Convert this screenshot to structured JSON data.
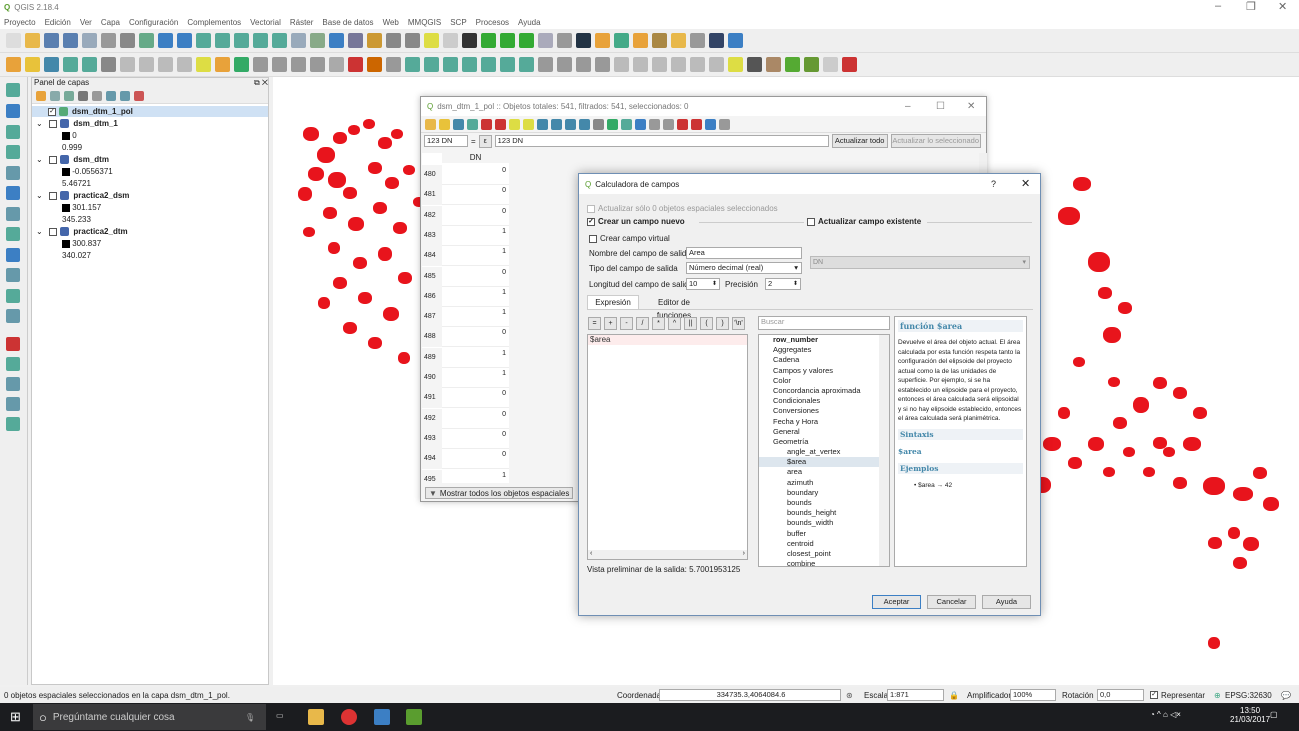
{
  "window": {
    "title": "QGIS 2.18.4"
  },
  "menu": [
    "Proyecto",
    "Edición",
    "Ver",
    "Capa",
    "Configuración",
    "Complementos",
    "Vectorial",
    "Ráster",
    "Base de datos",
    "Web",
    "MMQGIS",
    "SCP",
    "Procesos",
    "Ayuda"
  ],
  "layers_panel": {
    "title": "Panel de capas",
    "items": [
      {
        "name": "dsm_dtm_1_pol",
        "values": []
      },
      {
        "name": "dsm_dtm_1",
        "values": [
          "0",
          "0.999"
        ]
      },
      {
        "name": "dsm_dtm",
        "values": [
          "-0.0556371",
          "5.46721"
        ]
      },
      {
        "name": "practica2_dsm",
        "values": [
          "301.157",
          "345.233"
        ]
      },
      {
        "name": "practica2_dtm",
        "values": [
          "300.837",
          "340.027"
        ]
      }
    ]
  },
  "attr_table": {
    "title": "dsm_dtm_1_pol :: Objetos totales: 541, filtrados: 541, seleccionados: 0",
    "field_selector": "123 DN",
    "expr_text": "123 DN",
    "update_all": "Actualizar todo",
    "update_selected": "Actualizar lo seleccionado",
    "column": "DN",
    "rows": [
      {
        "id": "480",
        "dn": "0"
      },
      {
        "id": "481",
        "dn": "0"
      },
      {
        "id": "482",
        "dn": "0"
      },
      {
        "id": "483",
        "dn": "1"
      },
      {
        "id": "484",
        "dn": "1"
      },
      {
        "id": "485",
        "dn": "0"
      },
      {
        "id": "486",
        "dn": "1"
      },
      {
        "id": "487",
        "dn": "1"
      },
      {
        "id": "488",
        "dn": "0"
      },
      {
        "id": "489",
        "dn": "1"
      },
      {
        "id": "490",
        "dn": "1"
      },
      {
        "id": "491",
        "dn": "0"
      },
      {
        "id": "492",
        "dn": "0"
      },
      {
        "id": "493",
        "dn": "0"
      },
      {
        "id": "494",
        "dn": "0"
      },
      {
        "id": "495",
        "dn": "1"
      }
    ],
    "show_all": "Mostrar todos los objetos espaciales"
  },
  "field_calc": {
    "title": "Calculadora de campos",
    "update_selected_only": "Actualizar sólo 0 objetos espaciales seleccionados",
    "create_field": "Crear un campo nuevo",
    "update_existing": "Actualizar campo existente",
    "virtual_field": "Crear campo virtual",
    "output_name_label": "Nombre del campo de salida",
    "output_name_value": "Area",
    "type_label": "Tipo del campo de salida",
    "type_value": "Número decimal (real)",
    "length_label": "Longitud del campo de salida",
    "length_value": "10",
    "precision_label": "Precisión",
    "precision_value": "2",
    "existing_field": "DN",
    "tab_expression": "Expresión",
    "tab_functions": "Editor de funciones",
    "operators": [
      "=",
      "+",
      "-",
      "/",
      "*",
      "^",
      "||",
      "(",
      ")",
      "'\\n'"
    ],
    "expression": "$area",
    "search_placeholder": "Buscar",
    "functions": [
      "row_number",
      "Aggregates",
      "Cadena",
      "Campos y valores",
      "Color",
      "Concordancia aproximada",
      "Condicionales",
      "Conversiones",
      "Fecha y Hora",
      "General",
      "Geometría",
      "angle_at_vertex",
      "$area",
      "area",
      "azimuth",
      "boundary",
      "bounds",
      "bounds_height",
      "bounds_width",
      "buffer",
      "centroid",
      "closest_point",
      "combine"
    ],
    "help_title": "función $area",
    "help_body": "Devuelve el área del objeto actual. El área calculada por esta función respeta tanto la configuración del elipsoide del proyecto actual como la de las unidades de superficie. Por ejemplo, si se ha establecido un elipsoide para el proyecto, entonces el área calculada será elipsoidal y si no hay elipsoide establecido, entonces el área calculada será planimétrica.",
    "syntax_title": "Sintaxis",
    "syntax_value": "$area",
    "examples_title": "Ejemplos",
    "example": "$area → 42",
    "preview_label": "Vista preliminar de la salida:",
    "preview_value": "5.7001953125",
    "ok": "Aceptar",
    "cancel": "Cancelar",
    "help": "Ayuda",
    "help_q": "?"
  },
  "status": {
    "message": "0 objetos espaciales seleccionados en la capa dsm_dtm_1_pol.",
    "coord_label": "Coordenada",
    "coord_value": "334735.3,4064084.6",
    "scale_label": "Escala",
    "scale_value": "1:871",
    "magnifier_label": "Amplificador",
    "magnifier_value": "100%",
    "rotation_label": "Rotación",
    "rotation_value": "0,0",
    "render_label": "Representar",
    "crs": "EPSG:32630"
  },
  "taskbar": {
    "search": "Pregúntame cualquier cosa",
    "time": "13:50",
    "date": "21/03/2017"
  },
  "colors": {
    "polygon": "#e8141c",
    "polygon_inner": "#8a8a2a",
    "accent": "#3c7fc4"
  }
}
